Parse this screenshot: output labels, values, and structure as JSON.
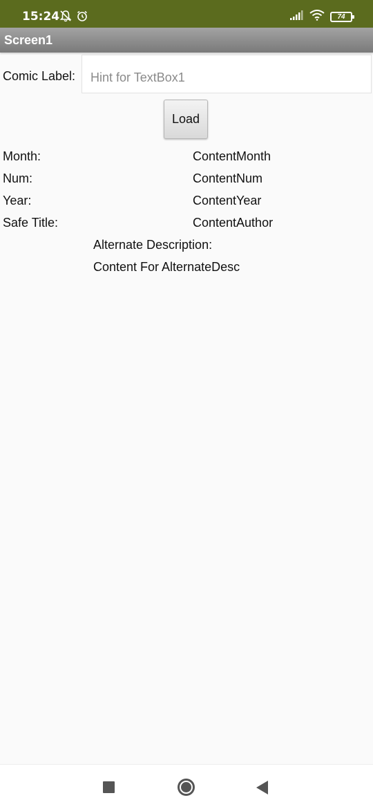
{
  "status_bar": {
    "time": "15:24",
    "battery": "74",
    "background": "#5b6b1e",
    "icons": [
      "mute-bell-icon",
      "alarm-icon",
      "signal-icon",
      "wifi-icon",
      "battery-icon"
    ]
  },
  "app": {
    "title": "Screen1",
    "comic_label": "Comic Label:",
    "comic_input_value": "",
    "comic_input_placeholder": "Hint for TextBox1",
    "load_button": "Load"
  },
  "details": [
    {
      "label": "Month:",
      "value": "ContentMonth"
    },
    {
      "label": "Num:",
      "value": "ContentNum"
    },
    {
      "label": "Year:",
      "value": "ContentYear"
    },
    {
      "label": "Safe Title:",
      "value": "ContentAuthor"
    }
  ],
  "alternate": {
    "label": "Alternate Description:",
    "value": "Content For AlternateDesc"
  },
  "nav": {
    "icons": [
      "recent-apps-icon",
      "home-icon",
      "back-icon"
    ]
  }
}
